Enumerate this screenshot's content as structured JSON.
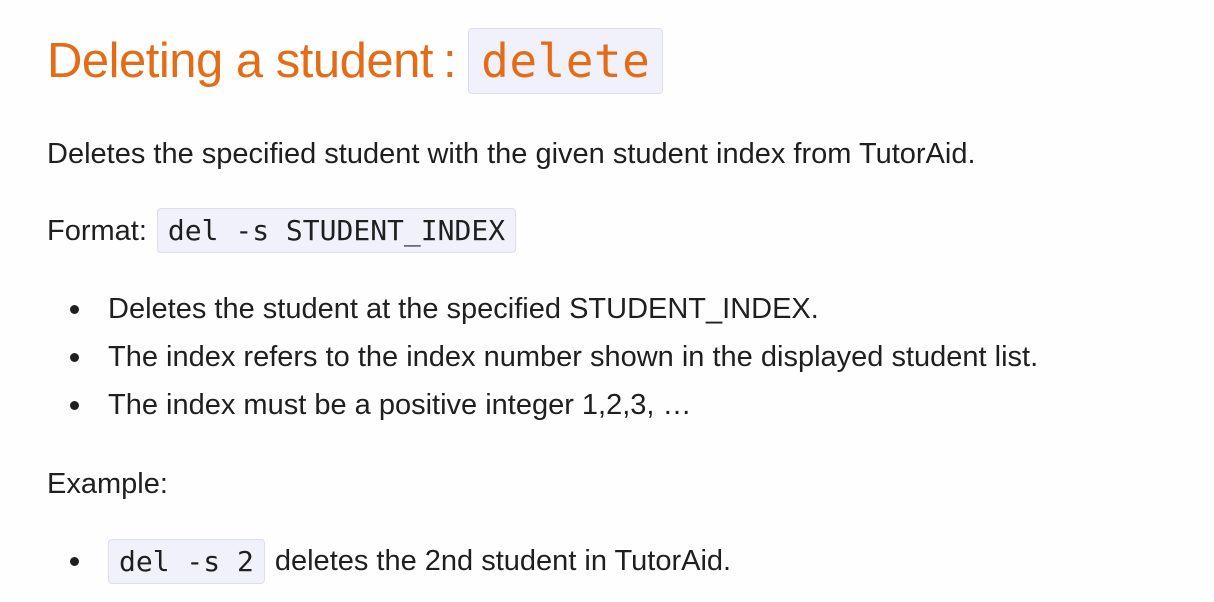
{
  "section": {
    "title_text": "Deleting a student",
    "title_separator": ":",
    "title_code": "delete"
  },
  "description": "Deletes the specified student with the given student index from TutorAid.",
  "format": {
    "label": "Format:",
    "code": "del -s STUDENT_INDEX"
  },
  "notes": [
    "Deletes the student at the specified STUDENT_INDEX.",
    "The index refers to the index number shown in the displayed student list.",
    "The index must be a positive integer 1,2,3, …"
  ],
  "example": {
    "label": "Example:",
    "items": [
      {
        "code": "del -s 2",
        "text": "deletes the 2nd student in TutorAid."
      }
    ]
  },
  "colors": {
    "heading": "#e46c16",
    "code_background": "#f1f1fb",
    "text": "#1f1f1f"
  }
}
